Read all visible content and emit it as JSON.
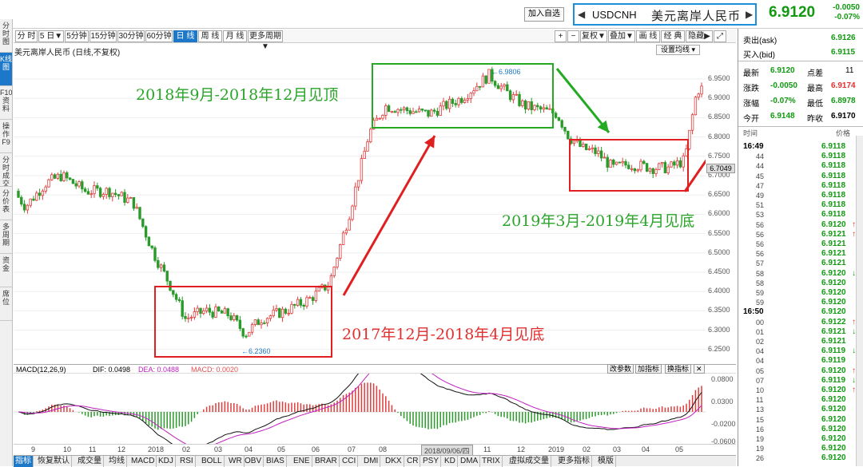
{
  "sidebar": [
    "分时图",
    "K线图",
    "F10资料",
    "操作F9",
    "分时成交",
    "分价表",
    "多周期",
    "资金",
    "席位"
  ],
  "header": {
    "add_watch": "加入自选",
    "code": "USDCNH",
    "name": "美元离岸人民币",
    "price": "6.9120",
    "change": "-0.0050",
    "change_pct": "-0.07%",
    "prev_arrow": "◀",
    "next_arrow": "▶"
  },
  "toolbar": {
    "left": [
      "分 时",
      "5 日▼",
      "5分钟",
      "15分钟",
      "30分钟",
      "60分钟",
      "日 线",
      "周 线",
      "月 线",
      "更多周期▼"
    ],
    "right": [
      "+",
      "−",
      "复权▼",
      "叠加▼",
      "画 线",
      "经 典",
      "隐藏▶",
      "⤢"
    ],
    "active": "日 线"
  },
  "chart_title": "美元离岸人民币 (日线,不复权)",
  "set_ma": "设置均线 ▾",
  "price_axis": [
    "6.9500",
    "6.9000",
    "6.8500",
    "6.8000",
    "6.7500",
    "6.7000",
    "6.6500",
    "6.6000",
    "6.5500",
    "6.5000",
    "6.4500",
    "6.4000",
    "6.3500",
    "6.3000",
    "6.2500"
  ],
  "current_price_tag": "6.7049",
  "high_marker": "6.9806",
  "low_marker": "6.2360",
  "macd": {
    "label": "MACD(12,26,9)",
    "dif": "DIF: 0.0498",
    "dea": "DEA: 0.0488",
    "macd": "MACD: 0.0020",
    "buttons": [
      "改参数",
      "加指标",
      "换指标",
      "✕"
    ],
    "axis": [
      "0.0800",
      "0.0300",
      "-0.0200",
      "-0.0600"
    ]
  },
  "x_axis": [
    "9",
    "10",
    "11",
    "12",
    "2018",
    "02",
    "03",
    "04",
    "05",
    "06",
    "07",
    "08",
    "2018/09/06/四",
    "11",
    "12",
    "2019",
    "02",
    "03",
    "04",
    "05"
  ],
  "tabs": [
    "指标",
    "恢复默认",
    "成交量",
    "均线",
    "MACD",
    "KDJ",
    "RSI",
    "BOLL",
    "WR",
    "OBV",
    "BIAS",
    "ENE",
    "BRAR",
    "CCI",
    "DMI",
    "DKX",
    "CR",
    "PSY",
    "KD",
    "DMA",
    "TRIX",
    "虚拟成交量",
    "更多指标",
    "模版"
  ],
  "active_tab": "指标",
  "annotations": [
    "2018年9月-2018年12月见顶",
    "2019年3月-2019年4月见底",
    "2017年12月-2018年4月见底"
  ],
  "colors": {
    "up": "#e03c3c",
    "down": "#2a9a2a",
    "box_green": "#22aa22",
    "box_red": "#e02020",
    "accent": "#1d78c9",
    "annot_green": "#2aa52a",
    "annot_red": "#e03030"
  },
  "quote": {
    "ask_label": "卖出(ask)",
    "ask": "6.9126",
    "bid_label": "买入(bid)",
    "bid": "6.9115",
    "latest_label": "最新",
    "latest": "6.9120",
    "spread_label": "点差",
    "spread": "11",
    "chg_label": "涨跌",
    "chg": "-0.0050",
    "high_label": "最高",
    "high": "6.9174",
    "pct_label": "涨幅",
    "pct": "-0.07%",
    "low_label": "最低",
    "low": "6.8978",
    "open_label": "今开",
    "open": "6.9148",
    "prev_label": "昨收",
    "prev": "6.9170"
  },
  "ticks_header": {
    "time": "时间",
    "price": "价格"
  },
  "ticks": [
    {
      "t": "16:49",
      "p": "6.9118",
      "a": ""
    },
    {
      "t": "44",
      "p": "6.9118",
      "a": ""
    },
    {
      "t": "44",
      "p": "6.9118",
      "a": ""
    },
    {
      "t": "45",
      "p": "6.9118",
      "a": ""
    },
    {
      "t": "47",
      "p": "6.9118",
      "a": ""
    },
    {
      "t": "49",
      "p": "6.9118",
      "a": ""
    },
    {
      "t": "51",
      "p": "6.9118",
      "a": ""
    },
    {
      "t": "53",
      "p": "6.9118",
      "a": ""
    },
    {
      "t": "56",
      "p": "6.9120",
      "a": "↑"
    },
    {
      "t": "56",
      "p": "6.9121",
      "a": "↑"
    },
    {
      "t": "56",
      "p": "6.9121",
      "a": ""
    },
    {
      "t": "56",
      "p": "6.9121",
      "a": ""
    },
    {
      "t": "57",
      "p": "6.9121",
      "a": ""
    },
    {
      "t": "58",
      "p": "6.9120",
      "a": "↓"
    },
    {
      "t": "58",
      "p": "6.9120",
      "a": ""
    },
    {
      "t": "59",
      "p": "6.9120",
      "a": ""
    },
    {
      "t": "59",
      "p": "6.9120",
      "a": ""
    },
    {
      "t": "16:50",
      "p": "6.9120",
      "a": ""
    },
    {
      "t": "00",
      "p": "6.9122",
      "a": "↑"
    },
    {
      "t": "01",
      "p": "6.9121",
      "a": "↓"
    },
    {
      "t": "02",
      "p": "6.9121",
      "a": ""
    },
    {
      "t": "04",
      "p": "6.9119",
      "a": "↓"
    },
    {
      "t": "04",
      "p": "6.9119",
      "a": ""
    },
    {
      "t": "05",
      "p": "6.9120",
      "a": "↑"
    },
    {
      "t": "07",
      "p": "6.9119",
      "a": "↓"
    },
    {
      "t": "10",
      "p": "6.9120",
      "a": "↑"
    },
    {
      "t": "11",
      "p": "6.9120",
      "a": ""
    },
    {
      "t": "13",
      "p": "6.9120",
      "a": ""
    },
    {
      "t": "15",
      "p": "6.9120",
      "a": ""
    },
    {
      "t": "16",
      "p": "6.9120",
      "a": ""
    },
    {
      "t": "19",
      "p": "6.9120",
      "a": ""
    },
    {
      "t": "19",
      "p": "6.9120",
      "a": ""
    },
    {
      "t": "26",
      "p": "6.9120",
      "a": ""
    }
  ]
}
